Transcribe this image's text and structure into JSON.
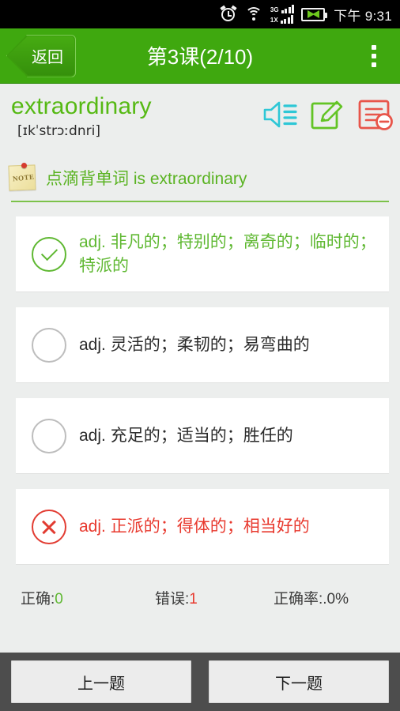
{
  "statusbar": {
    "time": "下午 9:31",
    "signal_3g_label": "3G",
    "signal_1x_label": "1X",
    "icons": [
      "alarm-clock-icon",
      "wifi-icon",
      "signal-icon",
      "battery-charging-icon"
    ]
  },
  "actionbar": {
    "back_label": "返回",
    "title": "第3课(2/10)",
    "overflow_label": "更多"
  },
  "word_header": {
    "word": "extraordinary",
    "phonetic": "[ɪkˈstrɔːdnri]",
    "icons": [
      {
        "name": "speaker-sound-icon",
        "color": "#2ec7d6"
      },
      {
        "name": "edit-pencil-icon",
        "color": "#63c425"
      },
      {
        "name": "remove-note-icon",
        "color": "#e8554a"
      }
    ]
  },
  "note": {
    "icon_text": "NOTE",
    "sentence": "点滴背单词 is extraordinary"
  },
  "options": [
    {
      "state": "correct",
      "mark": "check-circle-icon",
      "text": "adj. 非凡的；特别的；离奇的；临时的；特派的"
    },
    {
      "state": "neutral",
      "mark": "empty-circle-icon",
      "text": "adj. 灵活的；柔韧的；易弯曲的"
    },
    {
      "state": "neutral",
      "mark": "empty-circle-icon",
      "text": "adj. 充足的；适当的；胜任的"
    },
    {
      "state": "wrong",
      "mark": "cross-circle-icon",
      "text": "adj. 正派的；得体的；相当好的"
    }
  ],
  "stats": {
    "correct_label": "正确:",
    "correct_value": "0",
    "wrong_label": "错误:",
    "wrong_value": "1",
    "rate_label": "正确率:",
    "rate_value": ".0%"
  },
  "bottombar": {
    "prev_label": "上一题",
    "next_label": "下一题"
  },
  "colors": {
    "brand_green": "#3fa80f",
    "accent_green": "#5fb832",
    "error_red": "#e8392e",
    "statusbar_bg": "#000000",
    "bottombar_bg": "#4d4d4d"
  }
}
